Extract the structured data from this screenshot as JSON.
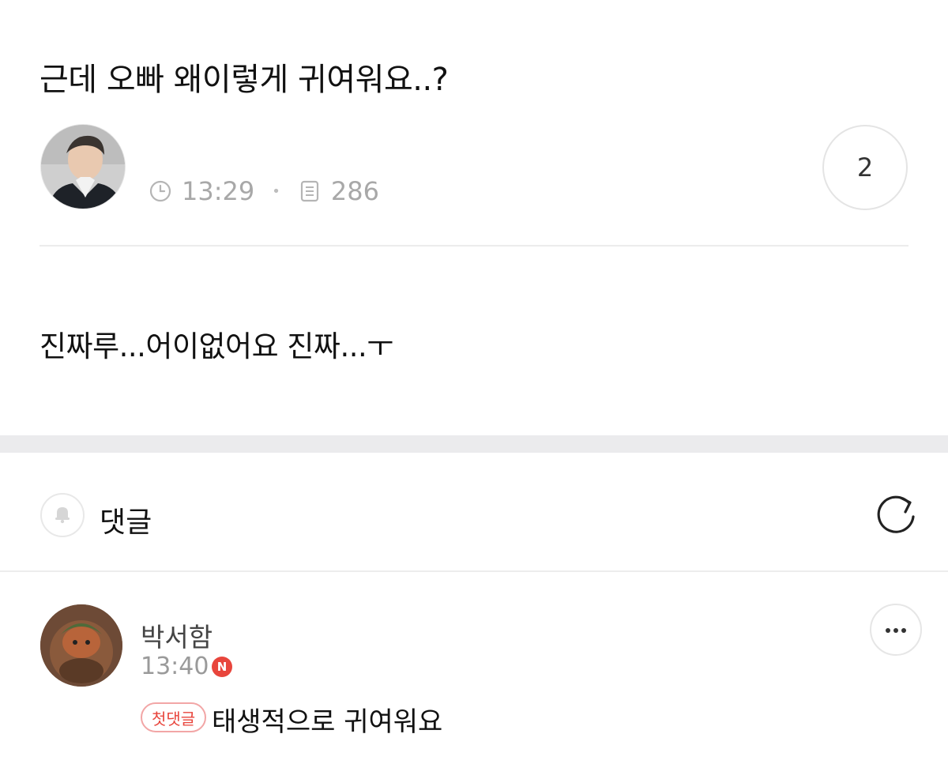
{
  "post": {
    "title": "근데 오빠 왜이렇게 귀여워요..?",
    "time": "13:29",
    "views": "286",
    "comment_count": "2",
    "body": "진짜루...어이없어요 진짜...ㅜ"
  },
  "icons": {
    "clock": "clock-icon",
    "views": "document-icon",
    "bell": "bell-icon",
    "refresh": "refresh-icon",
    "more": "more-horizontal-icon"
  },
  "comments_section": {
    "label": "댓글"
  },
  "comments": [
    {
      "author": "박서함",
      "time": "13:40",
      "new_badge": "N",
      "tag": "첫댓글",
      "text": "태생적으로 귀여워요"
    }
  ],
  "colors": {
    "accent_red": "#e8453c",
    "muted_gray": "#a8a8a8",
    "section_gap": "#ebebed"
  }
}
